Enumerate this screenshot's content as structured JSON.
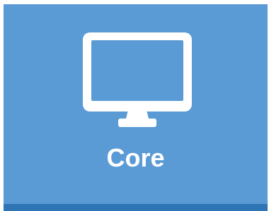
{
  "tile": {
    "label": "Core",
    "icon": "monitor-icon",
    "colors": {
      "background": "#5b9bd5",
      "bottom_bar": "#2e75b6",
      "foreground": "#ffffff"
    }
  }
}
